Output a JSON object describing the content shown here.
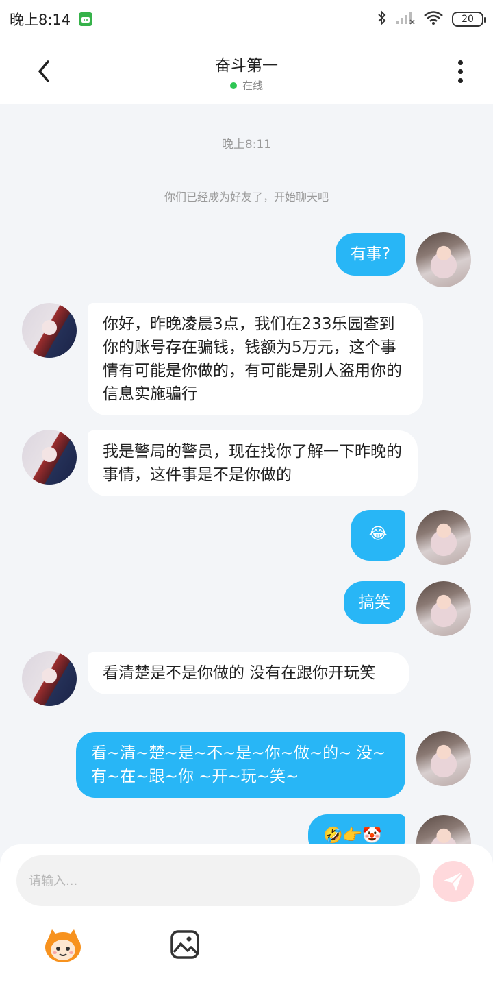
{
  "status_bar": {
    "time": "晚上8:14",
    "battery": "20"
  },
  "header": {
    "title": "奋斗第一",
    "status": "在线"
  },
  "chat": {
    "time_label": "晚上8:11",
    "system_message": "你们已经成为好友了，开始聊天吧",
    "messages": [
      {
        "sender": "me",
        "text": "有事?"
      },
      {
        "sender": "other",
        "text": "你好，昨晚凌晨3点，我们在233乐园查到你的账号存在骗钱，钱额为5万元，这个事情有可能是你做的，有可能是别人盗用你的信息实施骗行"
      },
      {
        "sender": "other",
        "text": "我是警局的警员，现在找你了解一下昨晚的事情，这件事是不是你做的"
      },
      {
        "sender": "me",
        "text": "😂"
      },
      {
        "sender": "me",
        "text": "搞笑"
      },
      {
        "sender": "other",
        "text": "看清楚是不是你做的 没有在跟你开玩笑"
      },
      {
        "sender": "me",
        "text": "看~清~楚~是~不~是~你~做~的~ 没~有~在~跟~你 ~开~玩~笑~"
      },
      {
        "sender": "me",
        "text": "🤣👉🤡"
      }
    ]
  },
  "input": {
    "placeholder": "请输入..."
  },
  "colors": {
    "my_bubble": "#28b6f6",
    "other_bubble": "#ffffff",
    "chat_background": "#f3f5f8",
    "online_dot": "#2dc653",
    "send_button": "#ffd9dc"
  }
}
